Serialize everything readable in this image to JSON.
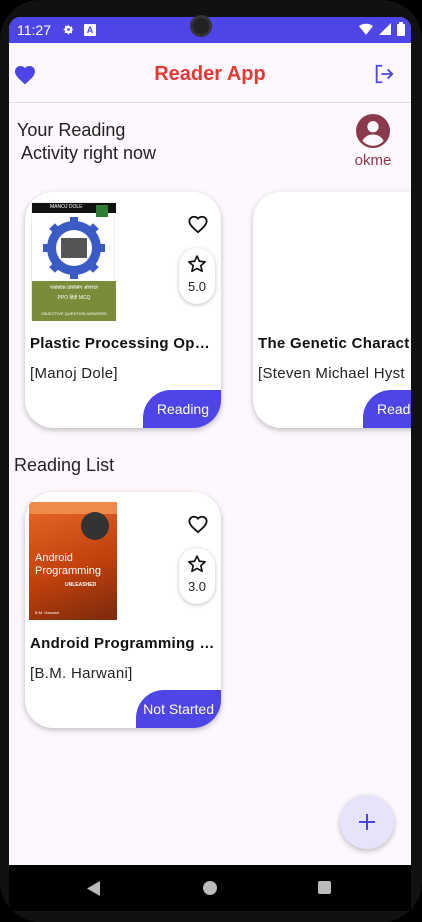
{
  "status_bar": {
    "time": "11:27"
  },
  "app_bar": {
    "title": "Reader App"
  },
  "reading_section": {
    "title_line1": "Your Reading",
    "title_line2": " Activity right now"
  },
  "profile": {
    "name": "okme"
  },
  "reading_now": [
    {
      "title": "Plastic Processing Ope…",
      "author": "[Manoj Dole]",
      "rating": "5.0",
      "status": "Reading",
      "cover_header": "MANOJ DOLE",
      "cover_caption": "प्लास्टिक प्रोसेसिंग ऑपरेटर",
      "cover_sub": "PPO हिंदी MCQ",
      "cover_footer": "OBJECTIVE QUESTION ANSWERS"
    },
    {
      "title": "The Genetic Charact",
      "author": "[Steven Michael Hyst",
      "status": "Read"
    }
  ],
  "reading_list_section": {
    "title": "Reading List"
  },
  "reading_list": [
    {
      "title": "Android Programming …",
      "author": "[B.M. Harwani]",
      "rating": "3.0",
      "status": "Not Started",
      "cover_title": "Android Programming",
      "cover_sub": "UNLEASHED",
      "cover_author": "B.M. Harwani"
    }
  ],
  "colors": {
    "primary": "#4d45e5",
    "title": "#e53935",
    "profile": "#8a3a4c",
    "background": "#fdf8fd"
  }
}
